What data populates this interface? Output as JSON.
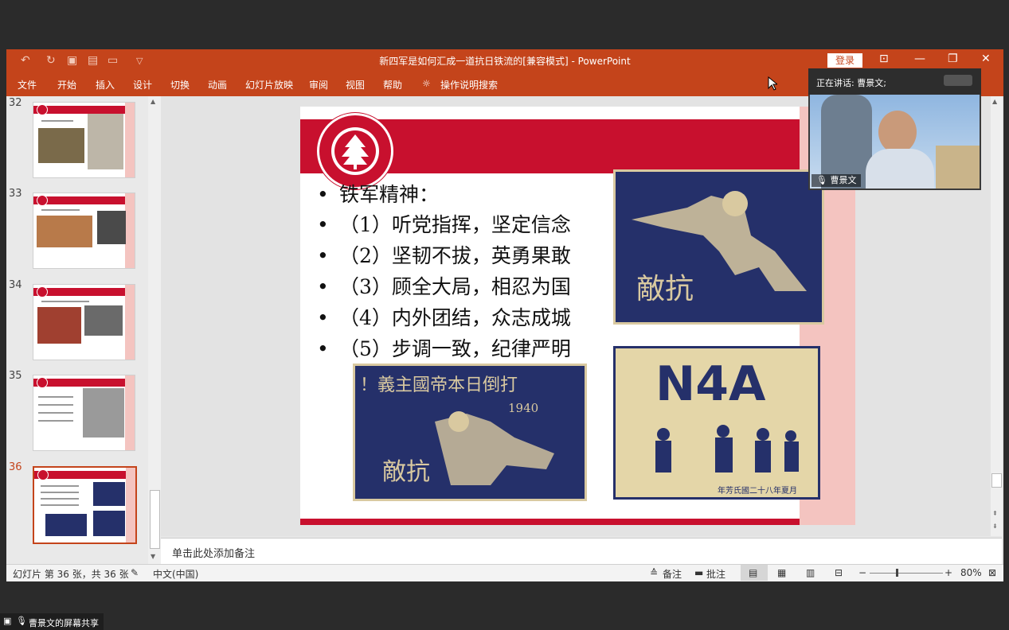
{
  "window": {
    "title": "新四军是如何汇成一道抗日铁流的[兼容模式]  -  PowerPoint",
    "login_label": "登录",
    "accent": "#c4441b"
  },
  "ribbon": {
    "tabs": [
      "文件",
      "开始",
      "插入",
      "设计",
      "切换",
      "动画",
      "幻灯片放映",
      "审阅",
      "视图",
      "帮助"
    ],
    "search": "操作说明搜索"
  },
  "thumbnails": [
    {
      "num": "32"
    },
    {
      "num": "33"
    },
    {
      "num": "34"
    },
    {
      "num": "35"
    },
    {
      "num": "36"
    }
  ],
  "slide": {
    "bullets": [
      "铁军精神：",
      "（1）听党指挥，坚定信念",
      "（2）坚韧不拔，英勇果敢",
      "（3）顾全大局，相忍为国",
      "（4）内外团结，众志成城",
      "（5）步调一致，纪律严明"
    ],
    "poster1_text": "敵抗",
    "poster2_title": "！義主國帝本日倒打",
    "poster2_year": "1940",
    "poster2_text": "敵抗",
    "poster3_title": "N4A",
    "poster3_caption": "年芳氏國二十八年夏月",
    "brand_red": "#c8102e"
  },
  "notes": {
    "placeholder": "单击此处添加备注"
  },
  "status": {
    "slide_info": "幻灯片 第 36 张，共 36 张",
    "language": "中文(中国)",
    "notes_btn": "备注",
    "comments_btn": "批注",
    "zoom": "80%"
  },
  "video": {
    "speaking": "正在讲话: 曹景文;",
    "name": "曹景文"
  },
  "share": {
    "label": "曹景文的屏幕共享"
  }
}
